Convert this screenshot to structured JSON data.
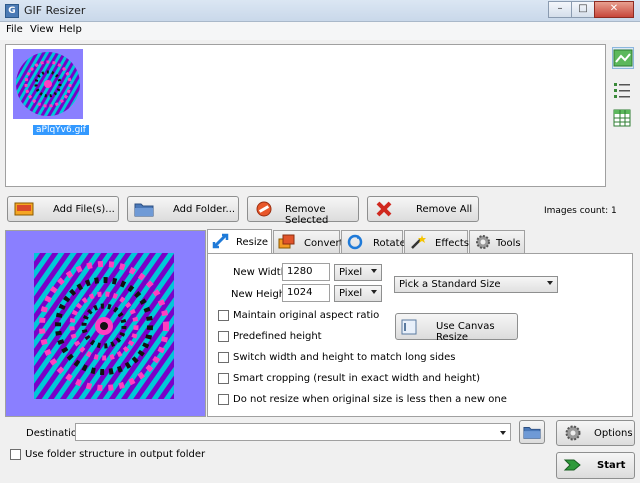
{
  "window": {
    "title": "GIF Resizer",
    "minimize": "–",
    "maximize": "□",
    "close": "✕",
    "app_icon": "gif-app-icon"
  },
  "menu": {
    "items": [
      "File",
      "View",
      "Help"
    ]
  },
  "file_list": {
    "items": [
      {
        "name": "aPlqYv6.gif",
        "selected": true
      }
    ]
  },
  "side_tools": [
    "thumbnail-view-icon",
    "list-view-icon",
    "details-view-icon"
  ],
  "actions": {
    "add_files": "Add File(s)...",
    "add_folder": "Add Folder...",
    "remove_selected": "Remove Selected",
    "remove_all": "Remove All"
  },
  "images_count": "Images count: 1",
  "tabs": [
    {
      "label": "Resize",
      "active": true
    },
    {
      "label": "Convert",
      "active": false
    },
    {
      "label": "Rotate",
      "active": false
    },
    {
      "label": "Effects",
      "active": false
    },
    {
      "label": "Tools",
      "active": false
    }
  ],
  "resize": {
    "new_width_label": "New Width",
    "new_width_value": "1280",
    "width_unit": "Pixel",
    "new_height_label": "New Height",
    "new_height_value": "1024",
    "height_unit": "Pixel",
    "standard_size": "Pick a Standard Size",
    "canvas_button": "Use Canvas Resize",
    "options": [
      "Maintain original aspect ratio",
      "Predefined height",
      "Switch width and height to match long sides",
      "Smart cropping (result in exact width and height)",
      "Do not resize when original size is less then a new one"
    ]
  },
  "destination": {
    "label": "Destination",
    "value": ""
  },
  "use_folder_structure": "Use folder structure in output folder",
  "options_button": "Options",
  "start_button": "Start",
  "colors": {
    "preview_bg": "#8a7fff",
    "selection": "#3399ff",
    "start_green": "#2e9a3a"
  }
}
